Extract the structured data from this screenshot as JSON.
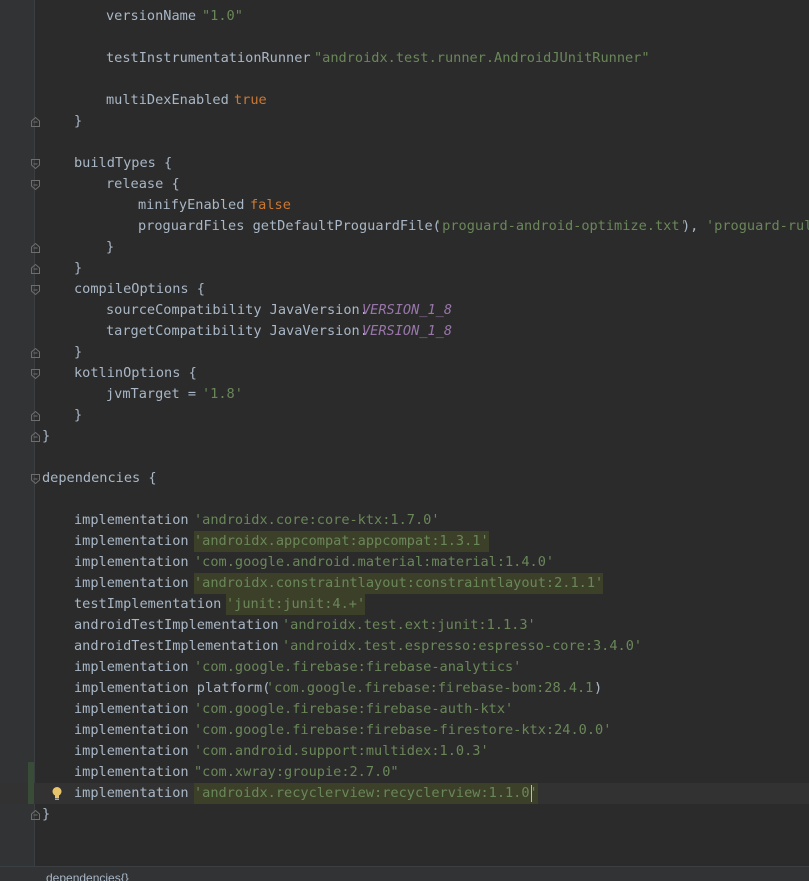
{
  "breadcrumb": "dependencies{}",
  "code_lines": [
    {
      "indent": 3,
      "tokens": [
        {
          "t": "versionName "
        },
        {
          "t": "\"1.0\"",
          "c": "str"
        }
      ]
    },
    {
      "indent": 0,
      "tokens": []
    },
    {
      "indent": 3,
      "tokens": [
        {
          "t": "testInstrumentationRunner "
        },
        {
          "t": "\"androidx.test.runner.AndroidJUnitRunner\"",
          "c": "str"
        }
      ]
    },
    {
      "indent": 0,
      "tokens": []
    },
    {
      "indent": 3,
      "tokens": [
        {
          "t": "multiDexEnabled "
        },
        {
          "t": "true",
          "c": "kw"
        }
      ]
    },
    {
      "indent": 2,
      "fold": "end",
      "tokens": [
        {
          "t": "}"
        }
      ]
    },
    {
      "indent": 0,
      "tokens": []
    },
    {
      "indent": 2,
      "fold": "start",
      "tokens": [
        {
          "t": "buildTypes {"
        }
      ]
    },
    {
      "indent": 3,
      "fold": "start",
      "tokens": [
        {
          "t": "release {"
        }
      ]
    },
    {
      "indent": 4,
      "tokens": [
        {
          "t": "minifyEnabled "
        },
        {
          "t": "false",
          "c": "kw"
        }
      ]
    },
    {
      "indent": 4,
      "tokens": [
        {
          "t": "proguardFiles getDefaultProguardFile("
        },
        {
          "t": "'proguard-android-optimize.txt'",
          "c": "str"
        },
        {
          "t": "), "
        },
        {
          "t": "'proguard-rules.pro'",
          "c": "str"
        }
      ]
    },
    {
      "indent": 3,
      "fold": "end",
      "tokens": [
        {
          "t": "}"
        }
      ]
    },
    {
      "indent": 2,
      "fold": "end",
      "tokens": [
        {
          "t": "}"
        }
      ]
    },
    {
      "indent": 2,
      "fold": "start",
      "tokens": [
        {
          "t": "compileOptions {"
        }
      ]
    },
    {
      "indent": 3,
      "tokens": [
        {
          "t": "sourceCompatibility JavaVersion."
        },
        {
          "t": "VERSION_1_8",
          "c": "const"
        }
      ]
    },
    {
      "indent": 3,
      "tokens": [
        {
          "t": "targetCompatibility JavaVersion."
        },
        {
          "t": "VERSION_1_8",
          "c": "const"
        }
      ]
    },
    {
      "indent": 2,
      "fold": "end",
      "tokens": [
        {
          "t": "}"
        }
      ]
    },
    {
      "indent": 2,
      "fold": "start",
      "tokens": [
        {
          "t": "kotlinOptions {"
        }
      ]
    },
    {
      "indent": 3,
      "tokens": [
        {
          "t": "jvmTarget = "
        },
        {
          "t": "'1.8'",
          "c": "str"
        }
      ]
    },
    {
      "indent": 2,
      "fold": "end",
      "tokens": [
        {
          "t": "}"
        }
      ]
    },
    {
      "indent": 1,
      "fold": "end",
      "tokens": [
        {
          "t": "}"
        }
      ]
    },
    {
      "indent": 0,
      "tokens": []
    },
    {
      "indent": 1,
      "fold": "start",
      "tokens": [
        {
          "t": "dependencies {"
        }
      ]
    },
    {
      "indent": 0,
      "tokens": []
    },
    {
      "indent": 2,
      "tokens": [
        {
          "t": "implementation "
        },
        {
          "t": "'androidx.core:core-ktx:1.7.0'",
          "c": "str"
        }
      ]
    },
    {
      "indent": 2,
      "tokens": [
        {
          "t": "implementation "
        },
        {
          "t": "'androidx.appcompat:appcompat:1.3.1'",
          "c": "str",
          "hl": true
        }
      ]
    },
    {
      "indent": 2,
      "tokens": [
        {
          "t": "implementation "
        },
        {
          "t": "'com.google.android.material:material:1.4.0'",
          "c": "str"
        }
      ]
    },
    {
      "indent": 2,
      "tokens": [
        {
          "t": "implementation "
        },
        {
          "t": "'androidx.constraintlayout:constraintlayout:2.1.1'",
          "c": "str",
          "hl": true
        }
      ]
    },
    {
      "indent": 2,
      "tokens": [
        {
          "t": "testImplementation "
        },
        {
          "t": "'junit:junit:4.+'",
          "c": "str",
          "hl": true
        }
      ]
    },
    {
      "indent": 2,
      "tokens": [
        {
          "t": "androidTestImplementation "
        },
        {
          "t": "'androidx.test.ext:junit:1.1.3'",
          "c": "str"
        }
      ]
    },
    {
      "indent": 2,
      "tokens": [
        {
          "t": "androidTestImplementation "
        },
        {
          "t": "'androidx.test.espresso:espresso-core:3.4.0'",
          "c": "str"
        }
      ]
    },
    {
      "indent": 2,
      "tokens": [
        {
          "t": "implementation "
        },
        {
          "t": "'com.google.firebase:firebase-analytics'",
          "c": "str"
        }
      ]
    },
    {
      "indent": 2,
      "tokens": [
        {
          "t": "implementation platform("
        },
        {
          "t": "'com.google.firebase:firebase-bom:28.4.1'",
          "c": "str"
        },
        {
          "t": ")"
        }
      ]
    },
    {
      "indent": 2,
      "tokens": [
        {
          "t": "implementation "
        },
        {
          "t": "'com.google.firebase:firebase-auth-ktx'",
          "c": "str"
        }
      ]
    },
    {
      "indent": 2,
      "tokens": [
        {
          "t": "implementation "
        },
        {
          "t": "'com.google.firebase:firebase-firestore-ktx:24.0.0'",
          "c": "str"
        }
      ]
    },
    {
      "indent": 2,
      "tokens": [
        {
          "t": "implementation "
        },
        {
          "t": "'com.android.support:multidex:1.0.3'",
          "c": "str"
        }
      ]
    },
    {
      "indent": 2,
      "changed": true,
      "tokens": [
        {
          "t": "implementation "
        },
        {
          "t": "\"com.xwray:groupie:2.7.0\"",
          "c": "str"
        }
      ]
    },
    {
      "indent": 2,
      "changed": true,
      "current": true,
      "bulb": true,
      "caret": true,
      "tokens": [
        {
          "t": "implementation "
        },
        {
          "t": "'androidx.recyclerview:recyclerview:1.1.0'",
          "c": "str",
          "hl": true
        }
      ]
    },
    {
      "indent": 1,
      "fold": "end",
      "tokens": [
        {
          "t": "}"
        }
      ]
    }
  ],
  "icons": {
    "fold": "fold-icon",
    "bulb": "lightbulb-icon"
  },
  "colors": {
    "background": "#2b2b2b",
    "text": "#a9b7c6",
    "string": "#6a8759",
    "keyword": "#cc7832",
    "constant": "#9876aa",
    "highlight": "#3b3c2b",
    "bulb": "#e8c46a"
  }
}
